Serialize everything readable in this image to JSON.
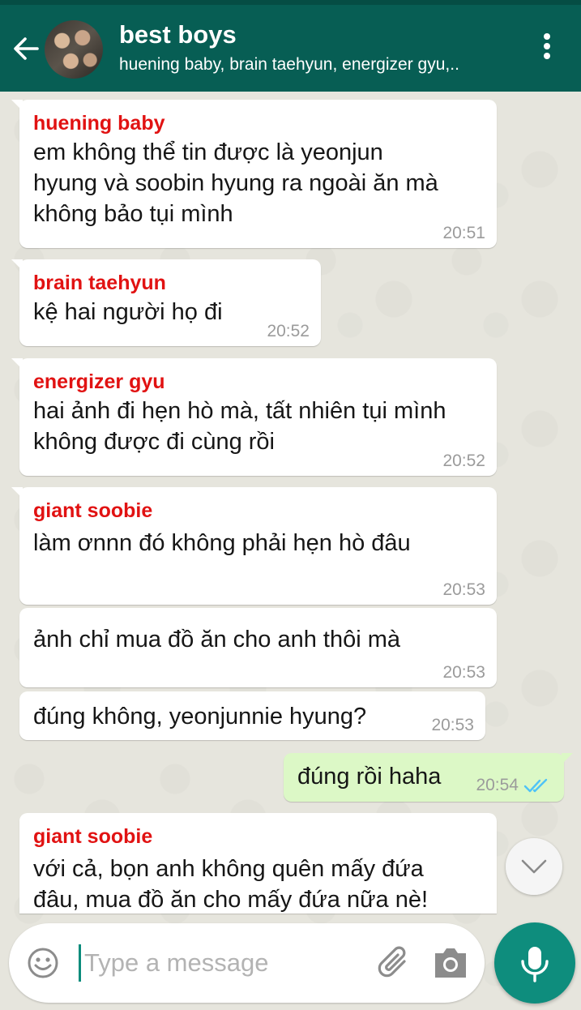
{
  "header": {
    "title": "best boys",
    "subtitle": "huening baby, brain taehyun, energizer gyu,.."
  },
  "messages": [
    {
      "sender": "huening baby",
      "lines": [
        "em không thể tin được là yeonjun",
        "hyung và soobin hyung ra ngoài ăn mà",
        "không bảo tụi mình"
      ],
      "time": "20:51"
    },
    {
      "sender": "brain taehyun",
      "lines": [
        "kệ hai người họ đi"
      ],
      "time": "20:52"
    },
    {
      "sender": "energizer gyu",
      "lines": [
        "hai ảnh đi hẹn hò mà, tất nhiên tụi mình",
        "không được đi cùng rồi"
      ],
      "time": "20:52"
    },
    {
      "sender": "giant soobie",
      "lines": [
        "làm ơnnn đó không phải hẹn hò đâu"
      ],
      "time": "20:53"
    },
    {
      "lines": [
        "ảnh chỉ mua đồ ăn cho anh thôi mà"
      ],
      "time": "20:53"
    },
    {
      "lines": [
        "đúng không, yeonjunnie hyung?"
      ],
      "time": "20:53"
    },
    {
      "lines": [
        "đúng rồi haha"
      ],
      "time": "20:54",
      "outgoing": true,
      "status": "read"
    },
    {
      "sender": "giant soobie",
      "lines": [
        "với cả, bọn anh không quên mấy đứa",
        "đâu, mua đồ ăn cho mấy đứa nữa nè!"
      ]
    }
  ],
  "composer": {
    "placeholder": "Type a message"
  },
  "icons": {
    "back": "back-arrow-icon",
    "menu": "more-vertical-icon",
    "emoji": "emoji-icon",
    "attach": "paperclip-icon",
    "camera": "camera-icon",
    "mic": "microphone-icon",
    "scroll": "chevron-down-icon",
    "read": "double-check-icon"
  },
  "colors": {
    "header": "#075e54",
    "sender_name": "#e11212",
    "outgoing_bubble": "#dcf8c6",
    "mic_button": "#0e8d7d",
    "read_ticks": "#4fc3f7"
  }
}
